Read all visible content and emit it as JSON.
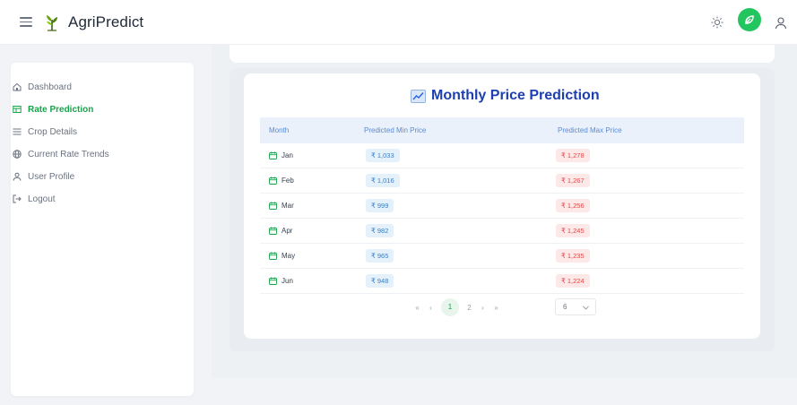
{
  "app": {
    "brand": "AgriPredict",
    "accent_color": "#16a34a",
    "title_color": "#1e40af"
  },
  "header": {
    "menu_icon": "hamburger-icon",
    "logo_icon": "plant-logo-icon",
    "theme_icon": "sun-icon",
    "avatar_icon": "leaf-avatar-icon",
    "profile_icon": "user-icon"
  },
  "sidebar": {
    "items": [
      {
        "label": "Dashboard",
        "icon": "home-icon",
        "active": false
      },
      {
        "label": "Rate Prediction",
        "icon": "table-icon",
        "active": true
      },
      {
        "label": "Crop Details",
        "icon": "list-icon",
        "active": false
      },
      {
        "label": "Current Rate Trends",
        "icon": "globe-icon",
        "active": false
      },
      {
        "label": "User Profile",
        "icon": "user-icon",
        "active": false
      },
      {
        "label": "Logout",
        "icon": "logout-icon",
        "active": false
      }
    ]
  },
  "card": {
    "title": "Monthly Price Prediction",
    "title_icon": "chart-icon"
  },
  "table": {
    "columns": [
      "Month",
      "Predicted Min Price",
      "Predicted Max Price"
    ],
    "rows": [
      {
        "month": "Jan",
        "min": "₹ 1,033",
        "max": "₹ 1,278"
      },
      {
        "month": "Feb",
        "min": "₹ 1,016",
        "max": "₹ 1,267"
      },
      {
        "month": "Mar",
        "min": "₹ 999",
        "max": "₹ 1,256"
      },
      {
        "month": "Apr",
        "min": "₹ 982",
        "max": "₹ 1,245"
      },
      {
        "month": "May",
        "min": "₹ 965",
        "max": "₹ 1,235"
      },
      {
        "month": "Jun",
        "min": "₹ 948",
        "max": "₹ 1,224"
      }
    ],
    "row_icon": "calendar-icon"
  },
  "pagination": {
    "first": "«",
    "prev": "‹",
    "pages": [
      "1",
      "2"
    ],
    "current": "1",
    "next": "›",
    "last": "»",
    "per_page": "6"
  }
}
